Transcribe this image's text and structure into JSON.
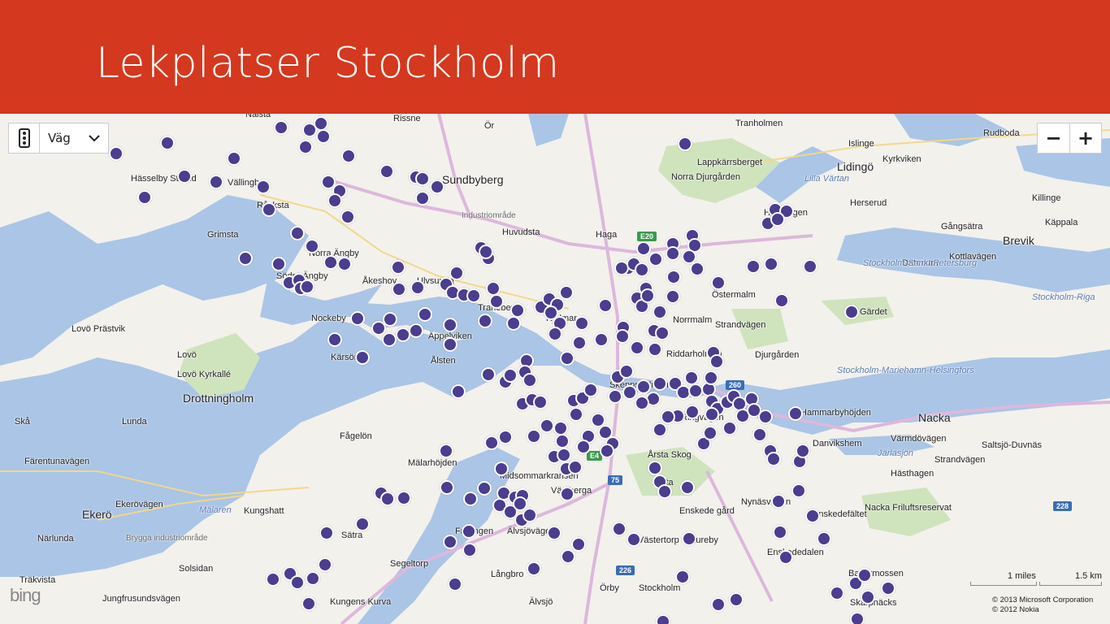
{
  "header": {
    "title": "Lekplatser Stockholm"
  },
  "map_controls": {
    "map_style": "Väg",
    "zoom_out": "−",
    "zoom_in": "+",
    "navigation_icon": "traffic-light-icon",
    "dropdown_icon": "chevron-down-icon"
  },
  "scale": {
    "miles": "1 miles",
    "km": "1.5 km"
  },
  "copyright": [
    "© 2013 Microsoft Corporation",
    "© 2012 Nokia"
  ],
  "logo": "bing",
  "colors": {
    "header": "#d4381e",
    "marker": "#4b3d8f",
    "water": "#aac5e6",
    "park": "#cfe3bd",
    "road": "#e6c9e6"
  },
  "labels": {
    "big": [
      "Sundbyberg",
      "Lidingö",
      "Drottningholm",
      "Nacka",
      "Ekerö",
      "Brevik"
    ],
    "places": [
      "Nälsta",
      "Rissne",
      "Ör",
      "Tranholmen",
      "Rudboda",
      "Hässelby Strand",
      "Vällingby",
      "Råcksta",
      "Islinge",
      "Kyrkviken",
      "Norra Djurgården",
      "Lappkärrsberget",
      "Herserud",
      "Killinge",
      "Hjorthagen",
      "Gångsätra",
      "Käppala",
      "Grimsta",
      "Huvudsta",
      "Haga",
      "Norra Ängby",
      "Södra Ängby",
      "Åkeshov",
      "Ulvsunda",
      "Tranebergs",
      "Hjalmar",
      "Nockeby",
      "Äppelviken",
      "Ålsten",
      "Östermalm",
      "Norrmalm",
      "Gärdet",
      "Riddarholmen",
      "Djurgården",
      "Strandvägen",
      "Kärsön",
      "Lovö Prästvik",
      "Lovö",
      "Lovö Kyrkallé",
      "Skå",
      "Lunda",
      "Fågelön",
      "Färentunavägen",
      "Mälarhöjden",
      "Midsommarkransen",
      "Årsta Skog",
      "Årsta",
      "Enskede gård",
      "Hästhagen",
      "Saltsjö-Duvnäs",
      "Värmdövägen",
      "Kungshatt",
      "Ekerövägen",
      "Närlunda",
      "Sätra",
      "Segeltorp",
      "Långbro",
      "Älvsjö",
      "Örby",
      "Stockholm",
      "Solsidan",
      "Träkvista",
      "Kungens Kurva",
      "Bagarmossen",
      "Skarpnäcks",
      "Enskededalen",
      "Jungfrusundsvägen",
      "Nacka Friluftsreservat",
      "Skeppsholmen",
      "Ringvägen",
      "Nynäsvägen",
      "Älvsjövägen",
      "Fruängen",
      "Västberga",
      "Västertorp",
      "Stureby",
      "Enskedefältet",
      "Hammarbyhöjden",
      "Danvikshem",
      "Strandvägen",
      "Datenum",
      "Kottlavägen"
    ],
    "water": [
      "Mälaren",
      "Lilla Värtan",
      "Järlasjön",
      "Stockholm-Sankt Petersburg",
      "Stockholm-Riga",
      "Stockholm-Mariehamn-Helsingfors"
    ],
    "grey": [
      "Industriområde",
      "Brygga industriområde"
    ],
    "roads": [
      "E20",
      "E4",
      "75",
      "260",
      "226",
      "228"
    ]
  }
}
